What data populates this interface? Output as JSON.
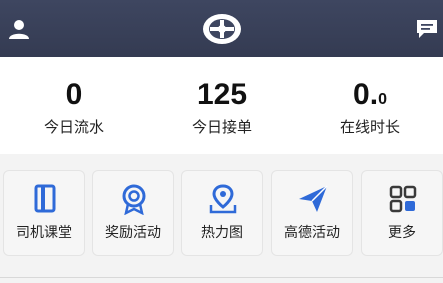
{
  "header": {
    "user_icon": "user-icon",
    "logo_icon": "didi-logo",
    "message_icon": "message-icon"
  },
  "stats": [
    {
      "value": "0",
      "label": "今日流水"
    },
    {
      "value": "125",
      "label": "今日接单"
    },
    {
      "value_main": "0.",
      "value_sub": "0",
      "label": "在线时长"
    }
  ],
  "tiles": [
    {
      "label": "司机课堂",
      "icon": "book-icon"
    },
    {
      "label": "奖励活动",
      "icon": "medal-icon"
    },
    {
      "label": "热力图",
      "icon": "map-pin-icon"
    },
    {
      "label": "高德活动",
      "icon": "paper-plane-icon"
    },
    {
      "label": "更多",
      "icon": "grid-icon"
    }
  ],
  "colors": {
    "header_bg": "#3e4660",
    "accent_blue": "#2f6ad8"
  }
}
